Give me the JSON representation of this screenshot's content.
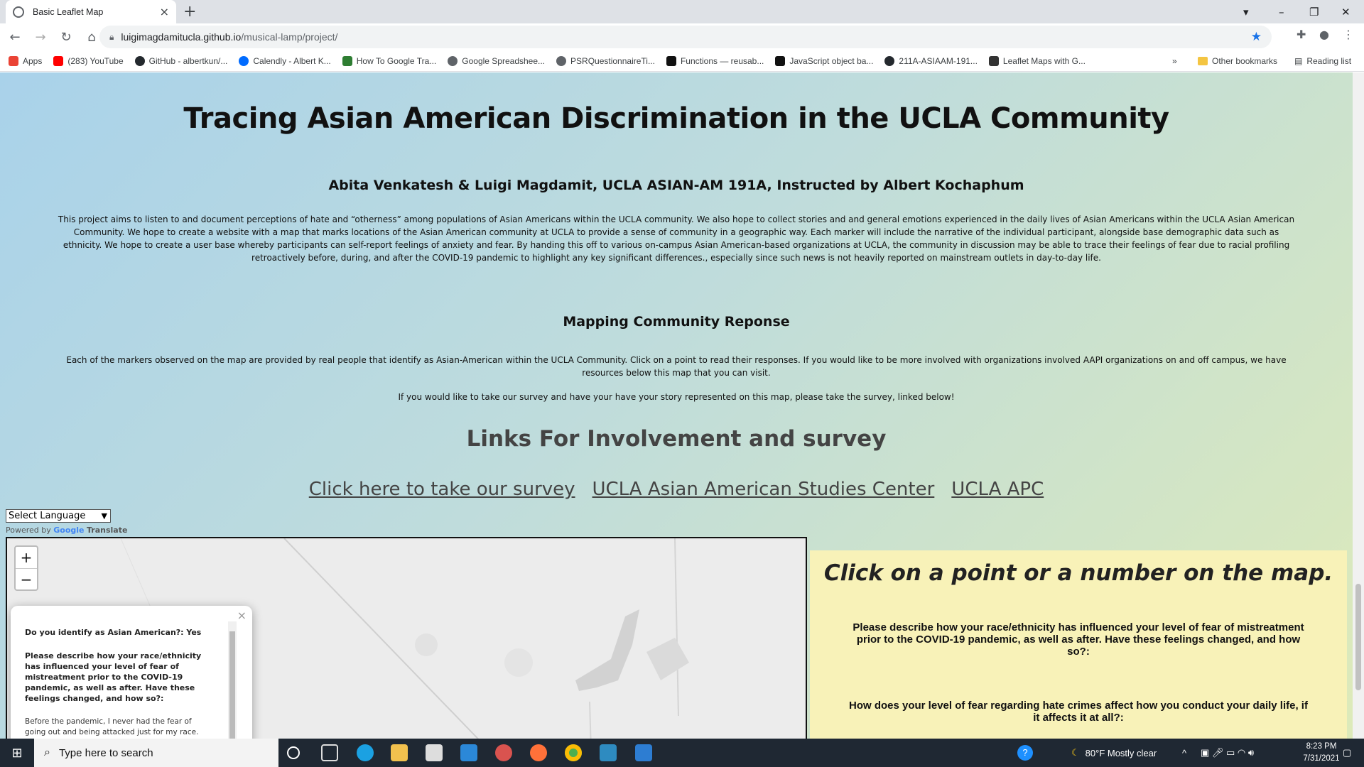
{
  "browser": {
    "tab_title": "Basic Leaflet Map",
    "new_tab": "+",
    "url_host": "luigimagdamitucla.github.io",
    "url_path": "/musical-lamp/project/",
    "window_controls": {
      "minimize": "–",
      "restore": "❐",
      "close": "✕"
    }
  },
  "bookmarks": {
    "items": [
      {
        "label": "Apps",
        "icon": "apps-grid-icon",
        "color": "#ea4335"
      },
      {
        "label": "(283) YouTube",
        "icon": "youtube-icon",
        "color": "#ff0000"
      },
      {
        "label": "GitHub - albertkun/...",
        "icon": "github-icon",
        "color": "#24292e"
      },
      {
        "label": "Calendly - Albert K...",
        "icon": "calendly-icon",
        "color": "#006bff"
      },
      {
        "label": "How To Google Tra...",
        "icon": "wordpress-w-icon",
        "color": "#2e7d32"
      },
      {
        "label": "Google Spreadshee...",
        "icon": "globe-icon",
        "color": "#5f6368"
      },
      {
        "label": "PSRQuestionnaireTi...",
        "icon": "globe-icon",
        "color": "#5f6368"
      },
      {
        "label": "Functions — reusab...",
        "icon": "javascript-icon",
        "color": "#111111"
      },
      {
        "label": "JavaScript object ba...",
        "icon": "javascript-icon",
        "color": "#111111"
      },
      {
        "label": "211A-ASIAAM-191...",
        "icon": "github-icon",
        "color": "#24292e"
      },
      {
        "label": "Leaflet Maps with G...",
        "icon": "leaflet-icon",
        "color": "#333333"
      }
    ],
    "overflow": "»",
    "other": "Other bookmarks",
    "reading_list": "Reading list"
  },
  "page": {
    "title": "Tracing Asian American Discrimination in the UCLA Community",
    "authors": "Abita Venkatesh & Luigi Magdamit, UCLA ASIAN-AM 191A, Instructed by Albert Kochaphum",
    "intro": "This project aims to listen to and document perceptions of hate and “otherness” among populations of Asian Americans within the UCLA community. We also hope to collect stories and and general emotions experienced in the daily lives of Asian Americans within the UCLA Asian American Community. We hope to create a website with a map that marks locations of the Asian American community at UCLA to provide a sense of community in a geographic way. Each marker will include the narrative of the individual participant, alongside base demographic data such as ethnicity. We hope to create a user base whereby participants can self-report feelings of anxiety and fear. By handing this off to various on-campus Asian American-based organizations at UCLA, the community in discussion may be able to trace their feelings of fear due to racial profiling retroactively before, during, and after the COVID-19 pandemic to highlight any key significant differences., especially since such news is not heavily reported on mainstream outlets in day-to-day life.",
    "section_title": "Mapping Community Reponse",
    "section_text": "Each of the markers observed on the map are provided by real people that identify as Asian-American within the UCLA Community. Click on a point to read their responses. If you would like to be more involved with organizations involved AAPI organizations on and off campus, we have resources below this map that you can visit.",
    "survey_text": "If you would like to take our survey and have your have your story represented on this map, please take the survey, linked below!",
    "links_title": "Links For Involvement and survey",
    "links": [
      "Click here to take our survey",
      "UCLA Asian American Studies Center",
      "UCLA APC"
    ],
    "language_select": "Select Language",
    "powered_by": "Powered by",
    "google": "Google",
    "translate": "Translate"
  },
  "map": {
    "zoom_in": "+",
    "zoom_out": "−",
    "popup": {
      "close": "×",
      "q1": "Do you identify as Asian American?: Yes",
      "q2": "Please describe how your race/ethnicity has influenced your level of fear of mistreatment prior to the COVID-19 pandemic, as well as after. Have these feelings changed, and how so?:",
      "answer": "Before the pandemic, I never had the fear of going out and being attacked just for my race. Now, I am"
    }
  },
  "panel": {
    "title": "Click on a point or a number on the map.",
    "q1": "Please describe how your race/ethnicity has influenced your level of fear of mistreatment prior to the COVID-19 pandemic, as well as after. Have these feelings changed, and how so?:",
    "q2": "How does your level of fear regarding hate crimes affect how you conduct your daily life, if it affects it at all?:"
  },
  "taskbar": {
    "search_placeholder": "Type here to search",
    "weather": "80°F  Mostly clear",
    "time": "8:23 PM",
    "date": "7/31/2021"
  },
  "colors": {
    "accent_blue": "#1a73e8",
    "panel_yellow": "#f8f2b8",
    "taskbar": "#1f2833"
  }
}
